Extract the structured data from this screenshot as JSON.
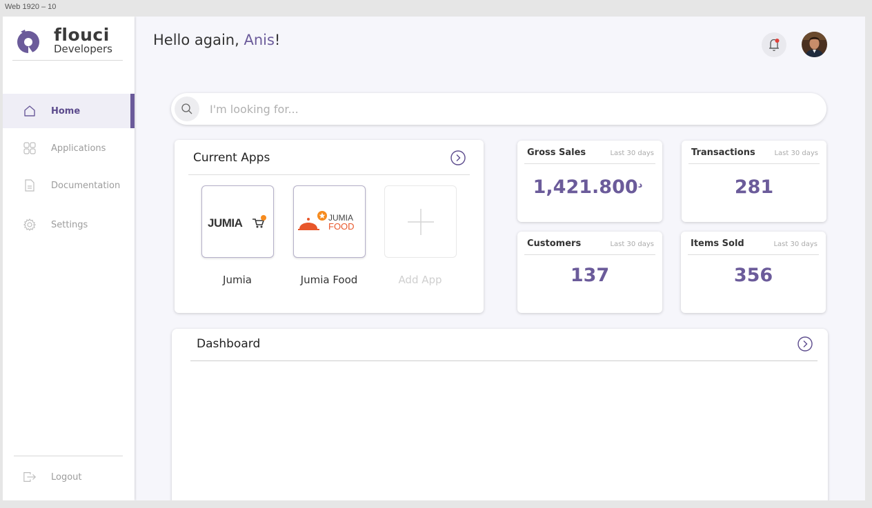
{
  "artboard_label": "Web 1920 – 10",
  "brand": {
    "title": "flouci",
    "subtitle": "Developers",
    "accent": "#6b5b9a"
  },
  "sidebar": {
    "items": [
      {
        "label": "Home",
        "icon": "home-icon",
        "active": true
      },
      {
        "label": "Applications",
        "icon": "grid-icon",
        "active": false
      },
      {
        "label": "Documentation",
        "icon": "document-icon",
        "active": false
      },
      {
        "label": "Settings",
        "icon": "gear-icon",
        "active": false
      }
    ],
    "logout": {
      "label": "Logout",
      "icon": "logout-icon"
    }
  },
  "header": {
    "greeting_prefix": "Hello again, ",
    "user_name": "Anis",
    "greeting_suffix": "!"
  },
  "search": {
    "placeholder": "I'm looking for...",
    "value": ""
  },
  "current_apps": {
    "title": "Current Apps",
    "apps": [
      {
        "name": "Jumia",
        "logo_text": "JUMIA"
      },
      {
        "name": "Jumia Food",
        "logo_text_top": "JUMIA",
        "logo_text_bottom": "FOOD"
      }
    ],
    "add_label": "Add App"
  },
  "stats": [
    {
      "label": "Gross Sales",
      "period": "Last 30 days",
      "value": "1,421.800",
      "currency_symbol": "د"
    },
    {
      "label": "Transactions",
      "period": "Last 30 days",
      "value": "281"
    },
    {
      "label": "Customers",
      "period": "Last 30 days",
      "value": "137"
    },
    {
      "label": "Items Sold",
      "period": "Last 30 days",
      "value": "356"
    }
  ],
  "dashboard": {
    "title": "Dashboard"
  },
  "colors": {
    "accent": "#6b5b9a",
    "notification_dot": "#e0413b",
    "jumia_orange": "#f68b1e",
    "jumia_food_red": "#e8562a"
  }
}
